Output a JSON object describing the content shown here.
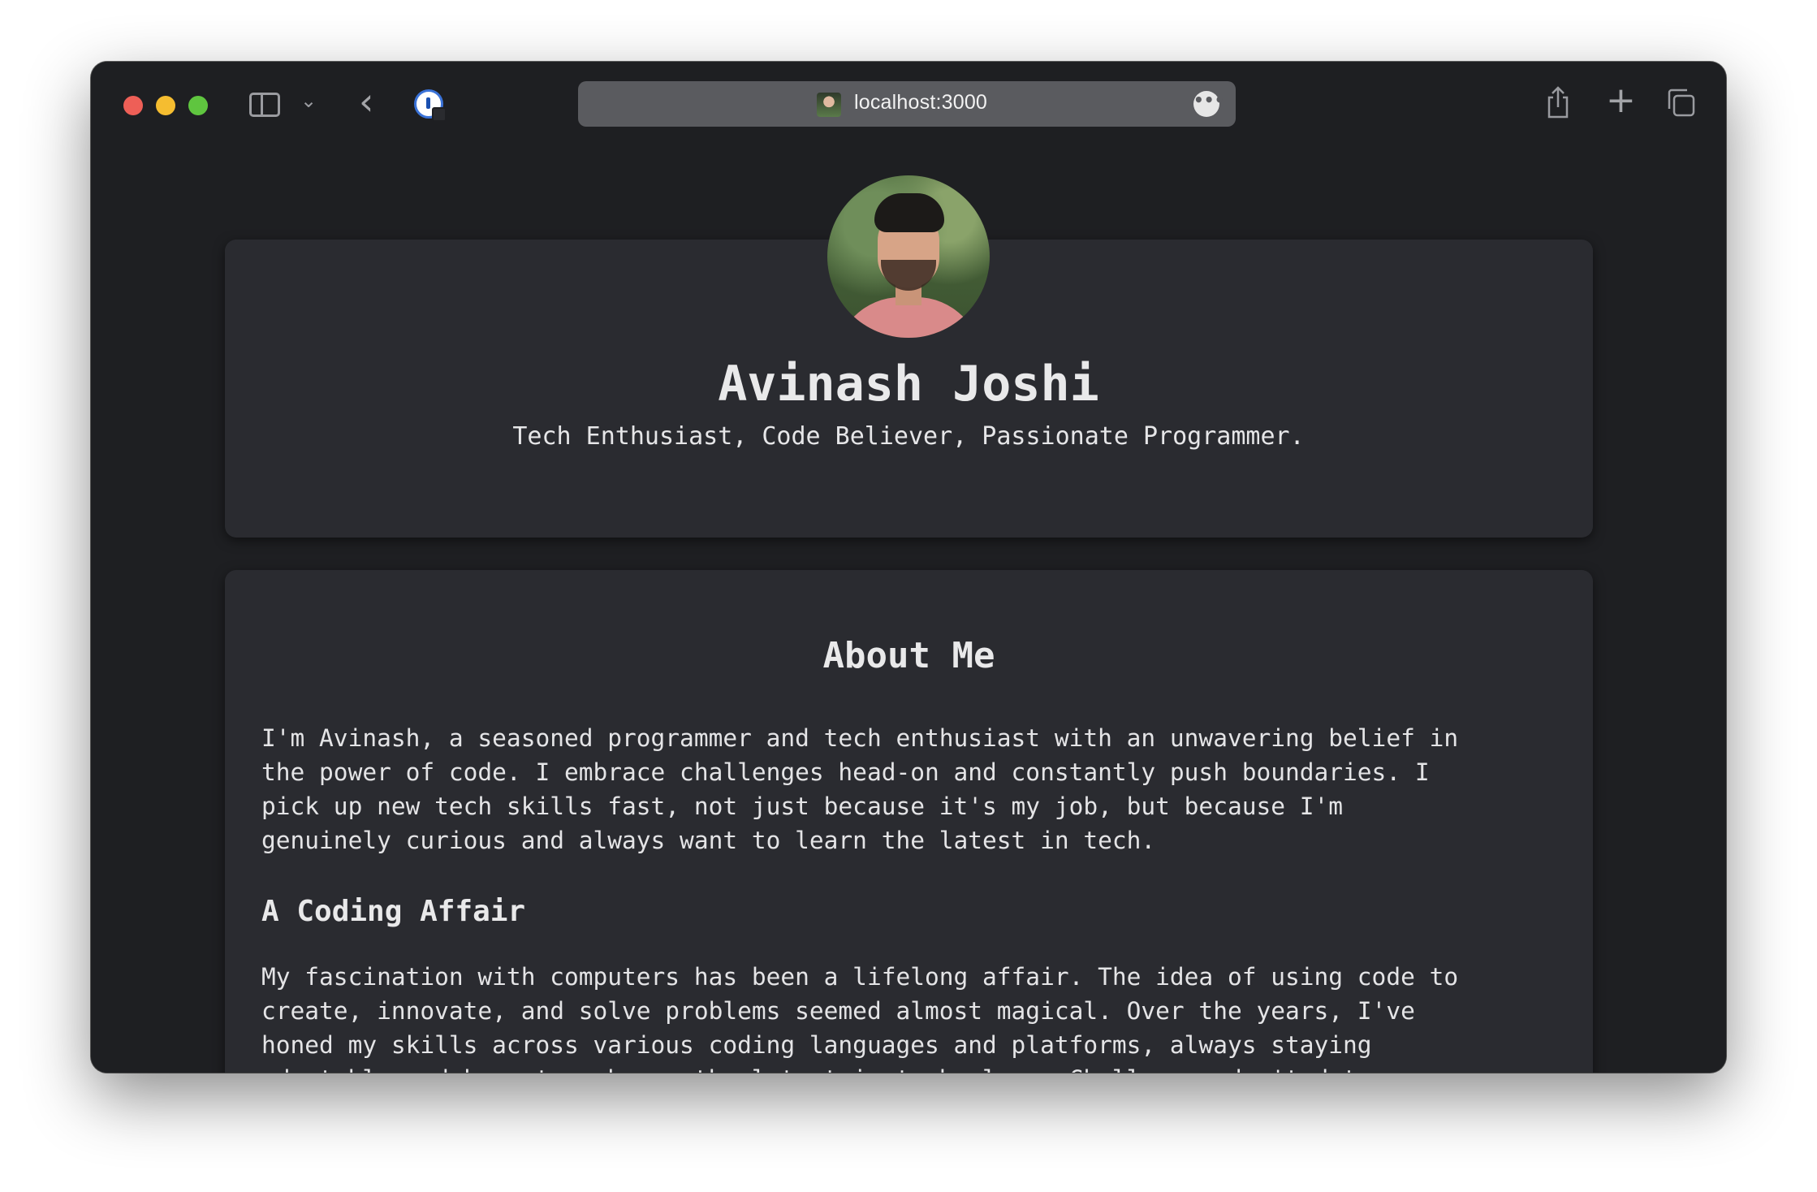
{
  "browser": {
    "url": "localhost:3000",
    "more_glyph": "•••",
    "back_glyph": "‹",
    "chevron_glyph": "⌄",
    "new_tab_glyph": "+"
  },
  "profile": {
    "name": "Avinash Joshi",
    "tagline": "Tech Enthusiast, Code Believer, Passionate Programmer."
  },
  "about": {
    "title": "About Me",
    "intro": "I'm Avinash, a seasoned programmer and tech enthusiast with an unwavering belief in\nthe power of code. I embrace challenges head-on and constantly push boundaries. I\npick up new tech skills fast, not just because it's my job, but because I'm\ngenuinely curious and always want to learn the latest in tech.",
    "subheading": "A Coding Affair",
    "coding_affair": "My fascination with computers has been a lifelong affair. The idea of using code to\ncreate, innovate, and solve problems seemed almost magical. Over the years, I've\nhoned my skills across various coding languages and platforms, always staying\nadaptable and keen to embrace the latest in technology. Challenges don't deter me;"
  },
  "colors": {
    "window_bg": "#1e1f22",
    "card_bg": "#2a2b30",
    "text": "#e6e6e8",
    "traffic_red": "#ee5f57",
    "traffic_yellow": "#f5bd30",
    "traffic_green": "#5fc53f"
  }
}
